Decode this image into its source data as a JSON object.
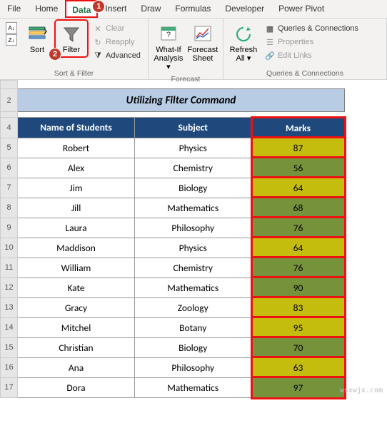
{
  "tabs": [
    "File",
    "Home",
    "Data",
    "Insert",
    "Draw",
    "Formulas",
    "Developer",
    "Power Pivot"
  ],
  "active_tab": "Data",
  "ribbon": {
    "sort_filter": {
      "group_label": "Sort & Filter",
      "sort_btn": "Sort",
      "filter_btn": "Filter",
      "clear": "Clear",
      "reapply": "Reapply",
      "advanced": "Advanced"
    },
    "forecast": {
      "group_label": "Forecast",
      "whatif_l1": "What-If",
      "whatif_l2": "Analysis",
      "fsheet_l1": "Forecast",
      "fsheet_l2": "Sheet"
    },
    "connections": {
      "group_label": "Queries & Connections",
      "refresh_l1": "Refresh",
      "refresh_l2": "All",
      "qc": "Queries & Connections",
      "props": "Properties",
      "links": "Edit Links"
    }
  },
  "callouts": {
    "one": "1",
    "two": "2"
  },
  "sheet": {
    "title": "Utilizing Filter Command",
    "headers": {
      "name": "Name of Students",
      "subject": "Subject",
      "marks": "Marks"
    },
    "row_nums": [
      "2",
      "4",
      "5",
      "6",
      "7",
      "8",
      "9",
      "10",
      "11",
      "12",
      "13",
      "14",
      "15",
      "16",
      "17"
    ],
    "rows": [
      {
        "name": "Robert",
        "subject": "Physics",
        "marks": 87,
        "color": "yellow"
      },
      {
        "name": "Alex",
        "subject": "Chemistry",
        "marks": 56,
        "color": "green"
      },
      {
        "name": "Jim",
        "subject": "Biology",
        "marks": 64,
        "color": "yellow"
      },
      {
        "name": "Jill",
        "subject": "Mathematics",
        "marks": 68,
        "color": "green"
      },
      {
        "name": "Laura",
        "subject": "Philosophy",
        "marks": 76,
        "color": "green"
      },
      {
        "name": "Maddison",
        "subject": "Physics",
        "marks": 64,
        "color": "yellow"
      },
      {
        "name": "William",
        "subject": "Chemistry",
        "marks": 76,
        "color": "green"
      },
      {
        "name": "Kate",
        "subject": "Mathematics",
        "marks": 90,
        "color": "green"
      },
      {
        "name": "Gracy",
        "subject": "Zoology",
        "marks": 83,
        "color": "yellow"
      },
      {
        "name": "Mitchel",
        "subject": "Botany",
        "marks": 95,
        "color": "yellow"
      },
      {
        "name": "Christian",
        "subject": "Biology",
        "marks": 70,
        "color": "green"
      },
      {
        "name": "Ana",
        "subject": "Philosophy",
        "marks": 63,
        "color": "yellow"
      },
      {
        "name": "Dora",
        "subject": "Mathematics",
        "marks": 97,
        "color": "green"
      }
    ]
  },
  "watermark": "wsxwjx.com"
}
